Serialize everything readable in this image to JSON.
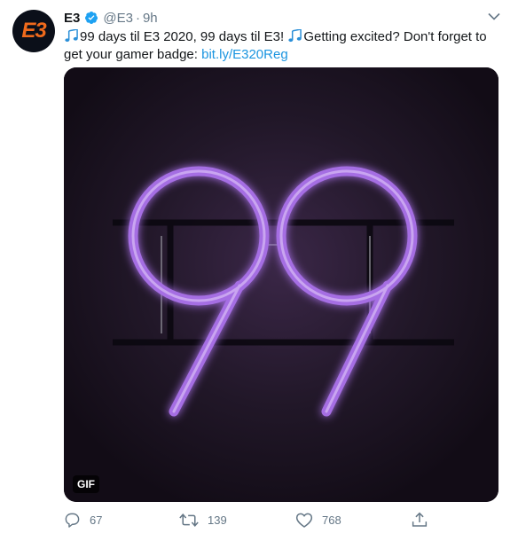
{
  "tweet": {
    "avatar_text": "E3",
    "name": "E3",
    "handle": "@E3",
    "separator": "·",
    "time": "9h",
    "text_part1": "99 days til E3 2020, 99 days til E3! ",
    "text_part2": "Getting excited? Don't forget to get your gamer badge: ",
    "link": "bit.ly/E320Reg",
    "media": {
      "badge": "GIF",
      "image_description": "Purple neon sign reading 99 on dark background"
    },
    "actions": {
      "replies": "67",
      "retweets": "139",
      "likes": "768"
    }
  },
  "colors": {
    "link": "#1b95e0",
    "verified": "#1da1f2",
    "neon": "#a56ee3",
    "muted": "#657786"
  },
  "icons": [
    "verified-badge-icon",
    "chevron-down-icon",
    "music-notes-icon",
    "reply-icon",
    "retweet-icon",
    "like-icon",
    "share-icon"
  ]
}
